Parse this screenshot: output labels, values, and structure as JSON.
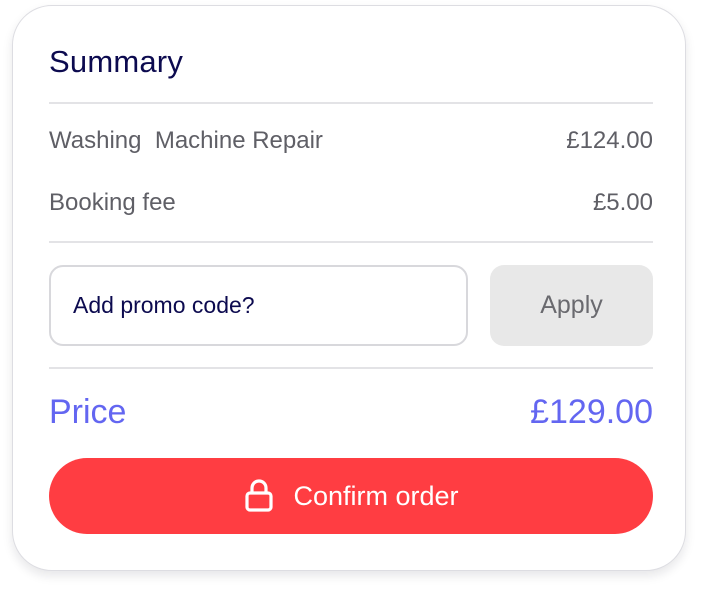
{
  "summary": {
    "title": "Summary",
    "items": [
      {
        "label": "Washing  Machine Repair",
        "value": "£124.00"
      },
      {
        "label": "Booking fee",
        "value": "£5.00"
      }
    ]
  },
  "promo": {
    "placeholder": "Add promo code?",
    "value": "",
    "apply_label": "Apply"
  },
  "total": {
    "label": "Price",
    "value": "£129.00"
  },
  "confirm": {
    "label": "Confirm order",
    "icon": "lock-icon"
  },
  "colors": {
    "title": "#0c0a4f",
    "accent": "#6366f1",
    "confirm_bg": "#ff3d42",
    "apply_bg": "#e8e8e8"
  }
}
